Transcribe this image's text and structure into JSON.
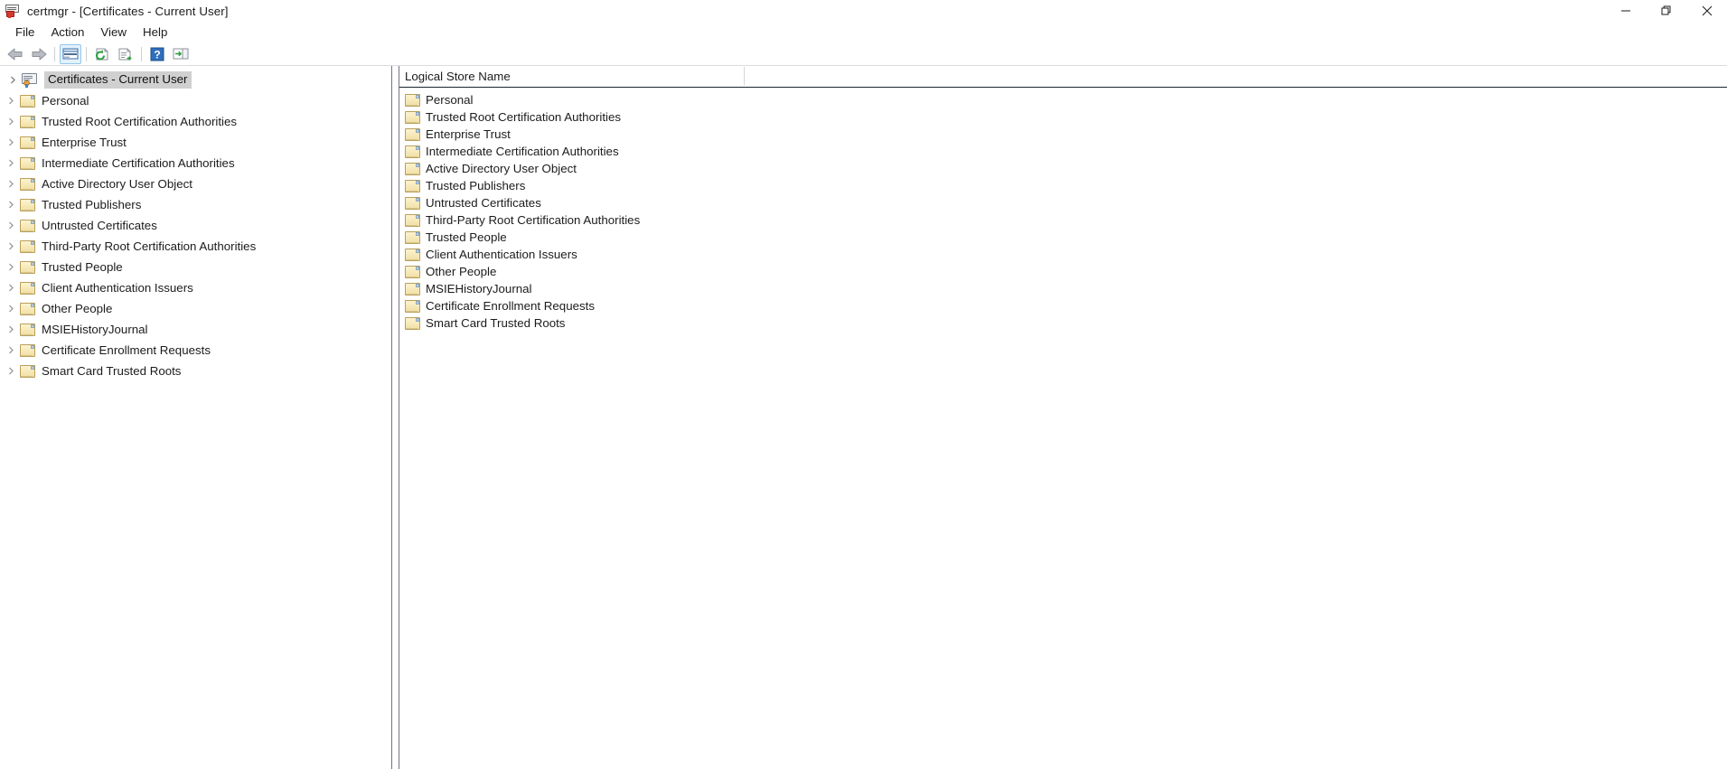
{
  "window": {
    "title": "certmgr - [Certificates - Current User]",
    "app_icon": "certificate-manager-icon",
    "controls": [
      {
        "name": "minimize-button",
        "glyph": "minimize"
      },
      {
        "name": "restore-button",
        "glyph": "restore"
      },
      {
        "name": "close-button",
        "glyph": "close"
      }
    ]
  },
  "menubar": {
    "items": [
      {
        "label": "File"
      },
      {
        "label": "Action"
      },
      {
        "label": "View"
      },
      {
        "label": "Help"
      }
    ]
  },
  "toolbar": {
    "buttons": [
      {
        "name": "back-button",
        "icon": "back-arrow-icon",
        "enabled": false
      },
      {
        "name": "forward-button",
        "icon": "forward-arrow-icon",
        "enabled": false
      },
      {
        "name": "show-hide-console-tree-button",
        "icon": "console-tree-icon",
        "active": true
      },
      {
        "name": "refresh-button",
        "icon": "refresh-icon",
        "active": false
      },
      {
        "name": "export-list-button",
        "icon": "export-list-icon",
        "active": false
      },
      {
        "name": "help-button",
        "icon": "help-icon",
        "active": false
      },
      {
        "name": "show-action-pane-button",
        "icon": "action-pane-icon",
        "active": false
      }
    ]
  },
  "tree": {
    "root": {
      "label": "Certificates - Current User",
      "icon": "certificate-store-icon",
      "selected": true
    },
    "items": [
      {
        "label": "Personal",
        "icon": "folder-icon"
      },
      {
        "label": "Trusted Root Certification Authorities",
        "icon": "folder-icon"
      },
      {
        "label": "Enterprise Trust",
        "icon": "folder-icon"
      },
      {
        "label": "Intermediate Certification Authorities",
        "icon": "folder-icon"
      },
      {
        "label": "Active Directory User Object",
        "icon": "folder-icon"
      },
      {
        "label": "Trusted Publishers",
        "icon": "folder-icon"
      },
      {
        "label": "Untrusted Certificates",
        "icon": "folder-icon"
      },
      {
        "label": "Third-Party Root Certification Authorities",
        "icon": "folder-icon"
      },
      {
        "label": "Trusted People",
        "icon": "folder-icon"
      },
      {
        "label": "Client Authentication Issuers",
        "icon": "folder-icon"
      },
      {
        "label": "Other People",
        "icon": "folder-icon"
      },
      {
        "label": "MSIEHistoryJournal",
        "icon": "folder-icon"
      },
      {
        "label": "Certificate Enrollment Requests",
        "icon": "folder-icon"
      },
      {
        "label": "Smart Card Trusted Roots",
        "icon": "folder-icon"
      }
    ]
  },
  "list": {
    "column_header": "Logical Store Name",
    "rows": [
      {
        "label": "Personal",
        "icon": "folder-icon"
      },
      {
        "label": "Trusted Root Certification Authorities",
        "icon": "folder-icon"
      },
      {
        "label": "Enterprise Trust",
        "icon": "folder-icon"
      },
      {
        "label": "Intermediate Certification Authorities",
        "icon": "folder-icon"
      },
      {
        "label": "Active Directory User Object",
        "icon": "folder-icon"
      },
      {
        "label": "Trusted Publishers",
        "icon": "folder-icon"
      },
      {
        "label": "Untrusted Certificates",
        "icon": "folder-icon"
      },
      {
        "label": "Third-Party Root Certification Authorities",
        "icon": "folder-icon"
      },
      {
        "label": "Trusted People",
        "icon": "folder-icon"
      },
      {
        "label": "Client Authentication Issuers",
        "icon": "folder-icon"
      },
      {
        "label": "Other People",
        "icon": "folder-icon"
      },
      {
        "label": "MSIEHistoryJournal",
        "icon": "folder-icon"
      },
      {
        "label": "Certificate Enrollment Requests",
        "icon": "folder-icon"
      },
      {
        "label": "Smart Card Trusted Roots",
        "icon": "folder-icon"
      }
    ]
  },
  "colors": {
    "text": "#1b1b1b",
    "folder_fill": "#f3e2a8",
    "folder_border": "#b9a05c",
    "selection": "#d0d0d0",
    "splitter": "#6f7580",
    "toolbar_active": "#e4f1fb"
  }
}
